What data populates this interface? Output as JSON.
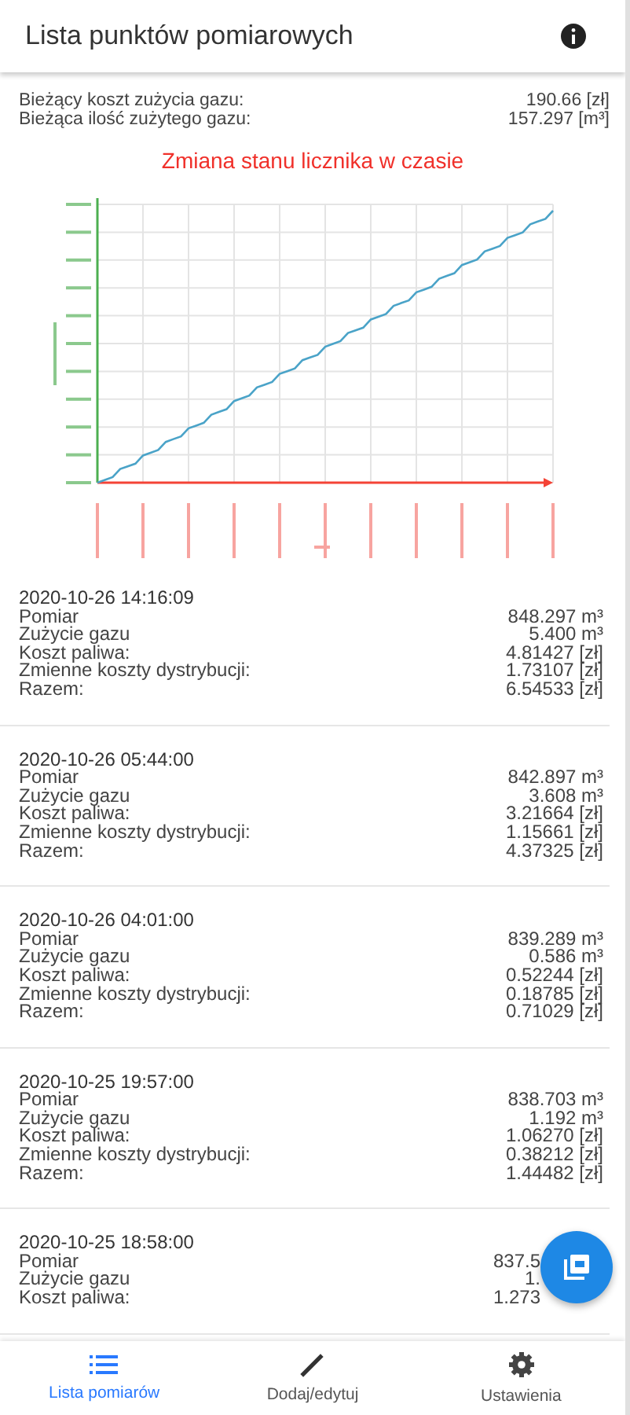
{
  "app_bar": {
    "title": "Lista punktów pomiarowych"
  },
  "summary": [
    {
      "label": "Bieżący koszt zużycia gazu:",
      "value": "190.66 [zł]"
    },
    {
      "label": "Bieżąca ilość zużytego gazu:",
      "value": "157.297 [m³]"
    }
  ],
  "chart": {
    "title": "Zmiana stanu licznika w czasie"
  },
  "entries": [
    {
      "datetime": "2020-10-26 14:16:09",
      "rows": [
        {
          "label": "Pomiar",
          "value": "848.297 m³"
        },
        {
          "label": "Zużycie gazu",
          "value": "5.400 m³"
        },
        {
          "label": "Koszt paliwa:",
          "value": "4.81427 [zł]"
        },
        {
          "label": "Zmienne koszty dystrybucji:",
          "value": "1.73107 [zł]"
        },
        {
          "label": "Razem:",
          "value": "6.54533 [zł]"
        }
      ]
    },
    {
      "datetime": "2020-10-26 05:44:00",
      "rows": [
        {
          "label": "Pomiar",
          "value": "842.897 m³"
        },
        {
          "label": "Zużycie gazu",
          "value": "3.608 m³"
        },
        {
          "label": "Koszt paliwa:",
          "value": "3.21664 [zł]"
        },
        {
          "label": "Zmienne koszty dystrybucji:",
          "value": "1.15661 [zł]"
        },
        {
          "label": "Razem:",
          "value": "4.37325 [zł]"
        }
      ]
    },
    {
      "datetime": "2020-10-26 04:01:00",
      "rows": [
        {
          "label": "Pomiar",
          "value": "839.289 m³"
        },
        {
          "label": "Zużycie gazu",
          "value": "0.586 m³"
        },
        {
          "label": "Koszt paliwa:",
          "value": "0.52244 [zł]"
        },
        {
          "label": "Zmienne koszty dystrybucji:",
          "value": "0.18785 [zł]"
        },
        {
          "label": "Razem:",
          "value": "0.71029 [zł]"
        }
      ]
    },
    {
      "datetime": "2020-10-25 19:57:00",
      "rows": [
        {
          "label": "Pomiar",
          "value": "838.703 m³"
        },
        {
          "label": "Zużycie gazu",
          "value": "1.192 m³"
        },
        {
          "label": "Koszt paliwa:",
          "value": "1.06270 [zł]"
        },
        {
          "label": "Zmienne koszty dystrybucji:",
          "value": "0.38212 [zł]"
        },
        {
          "label": "Razem:",
          "value": "1.44482 [zł]"
        }
      ]
    },
    {
      "datetime": "2020-10-25 18:58:00",
      "kind": "under-fab",
      "rows": [
        {
          "label": "Pomiar",
          "value": "837.5"
        },
        {
          "label": "Zużycie gazu",
          "value": "1."
        },
        {
          "label": "Koszt paliwa:",
          "value": "1.273"
        }
      ]
    }
  ],
  "bottom_nav": [
    {
      "label": "Lista pomiarów",
      "kind": "list",
      "selected": true
    },
    {
      "label": "Dodaj/edytuj",
      "kind": "pencil",
      "selected": false
    },
    {
      "label": "Ustawienia",
      "kind": "gear",
      "selected": false
    }
  ]
}
